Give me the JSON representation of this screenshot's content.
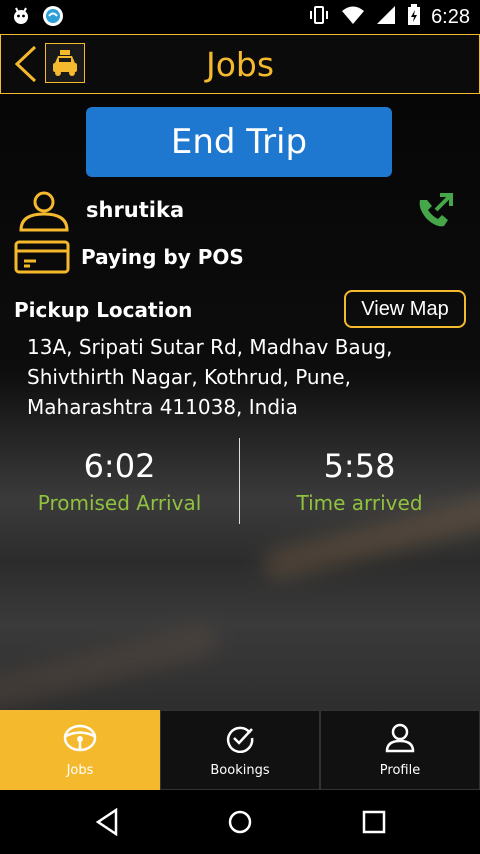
{
  "status_bar": {
    "time": "6:28",
    "icons": [
      "android-debug-icon",
      "app-notification-icon",
      "vibrate-icon",
      "wifi-icon",
      "signal-icon",
      "battery-icon"
    ]
  },
  "header": {
    "title": "Jobs",
    "back_icon": "chevron-left-icon",
    "logo_icon": "taxi-icon"
  },
  "trip": {
    "end_trip_label": "End Trip",
    "customer_name": "shrutika",
    "payment": "Paying by POS",
    "pickup_label": "Pickup Location",
    "view_map_label": "View Map",
    "address_lines": [
      "13A, Sripati Sutar Rd, Madhav Baug,",
      "Shivthirth Nagar, Kothrud, Pune,",
      "Maharashtra 411038, India"
    ]
  },
  "times": {
    "promised_time": "6:02",
    "promised_label": "Promised Arrival",
    "arrived_time": "5:58",
    "arrived_label": "Time arrived"
  },
  "tabs": [
    {
      "label": "Jobs",
      "icon": "steering-wheel-icon",
      "active": true
    },
    {
      "label": "Bookings",
      "icon": "check-circle-icon",
      "active": false
    },
    {
      "label": "Profile",
      "icon": "person-icon",
      "active": false
    }
  ],
  "colors": {
    "accent": "#f5b92e",
    "primary_button": "#1e78cf",
    "time_label": "#8fc23e",
    "phone_icon": "#46a64a"
  }
}
